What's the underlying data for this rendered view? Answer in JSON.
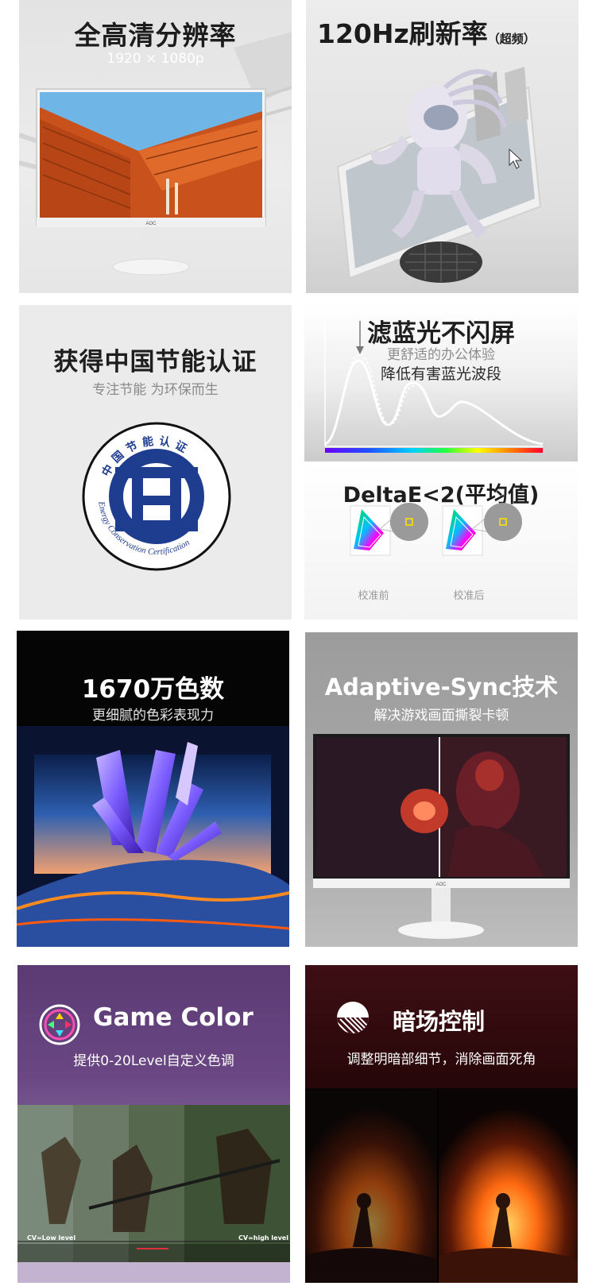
{
  "tiles": {
    "resolution": {
      "title": "全高清分辨率",
      "subtitle": "1920 × 1080p",
      "brand": "AOC"
    },
    "refresh": {
      "title": "120Hz刷新率",
      "note": "（超频）"
    },
    "energy": {
      "title": "获得中国节能认证",
      "subtitle": "专注节能 为环保而生",
      "seal_text_cn": "中国节能认证",
      "seal_text_en": "Energy Conservation Certification"
    },
    "blue_light": {
      "title": "滤蓝光不闪屏",
      "subtitle1": "更舒适的办公体验",
      "subtitle2": "降低有害蓝光波段"
    },
    "delta_e": {
      "title": "DeltaE<2(平均值)",
      "before_label": "校准前",
      "after_label": "校准后"
    },
    "colors": {
      "title": "1670万色数",
      "subtitle": "更细腻的色彩表现力"
    },
    "adaptive_sync": {
      "title": "Adaptive-Sync技术",
      "subtitle": "解决游戏画面撕裂卡顿",
      "brand": "AOC"
    },
    "game_color": {
      "title": "Game Color",
      "subtitle": "提供0-20Level自定义色调",
      "cv_low": "CV=Low level",
      "cv_high": "CV=high level"
    },
    "shadow_control": {
      "title": "暗场控制",
      "subtitle": "调整明暗部细节，消除画面死角"
    }
  },
  "colors": {
    "accent_dark": "#1c1c1c",
    "seal_blue": "#1f3d8f",
    "purple_bg": "#6a4783",
    "dark_red_bg": "#3e0f14"
  }
}
